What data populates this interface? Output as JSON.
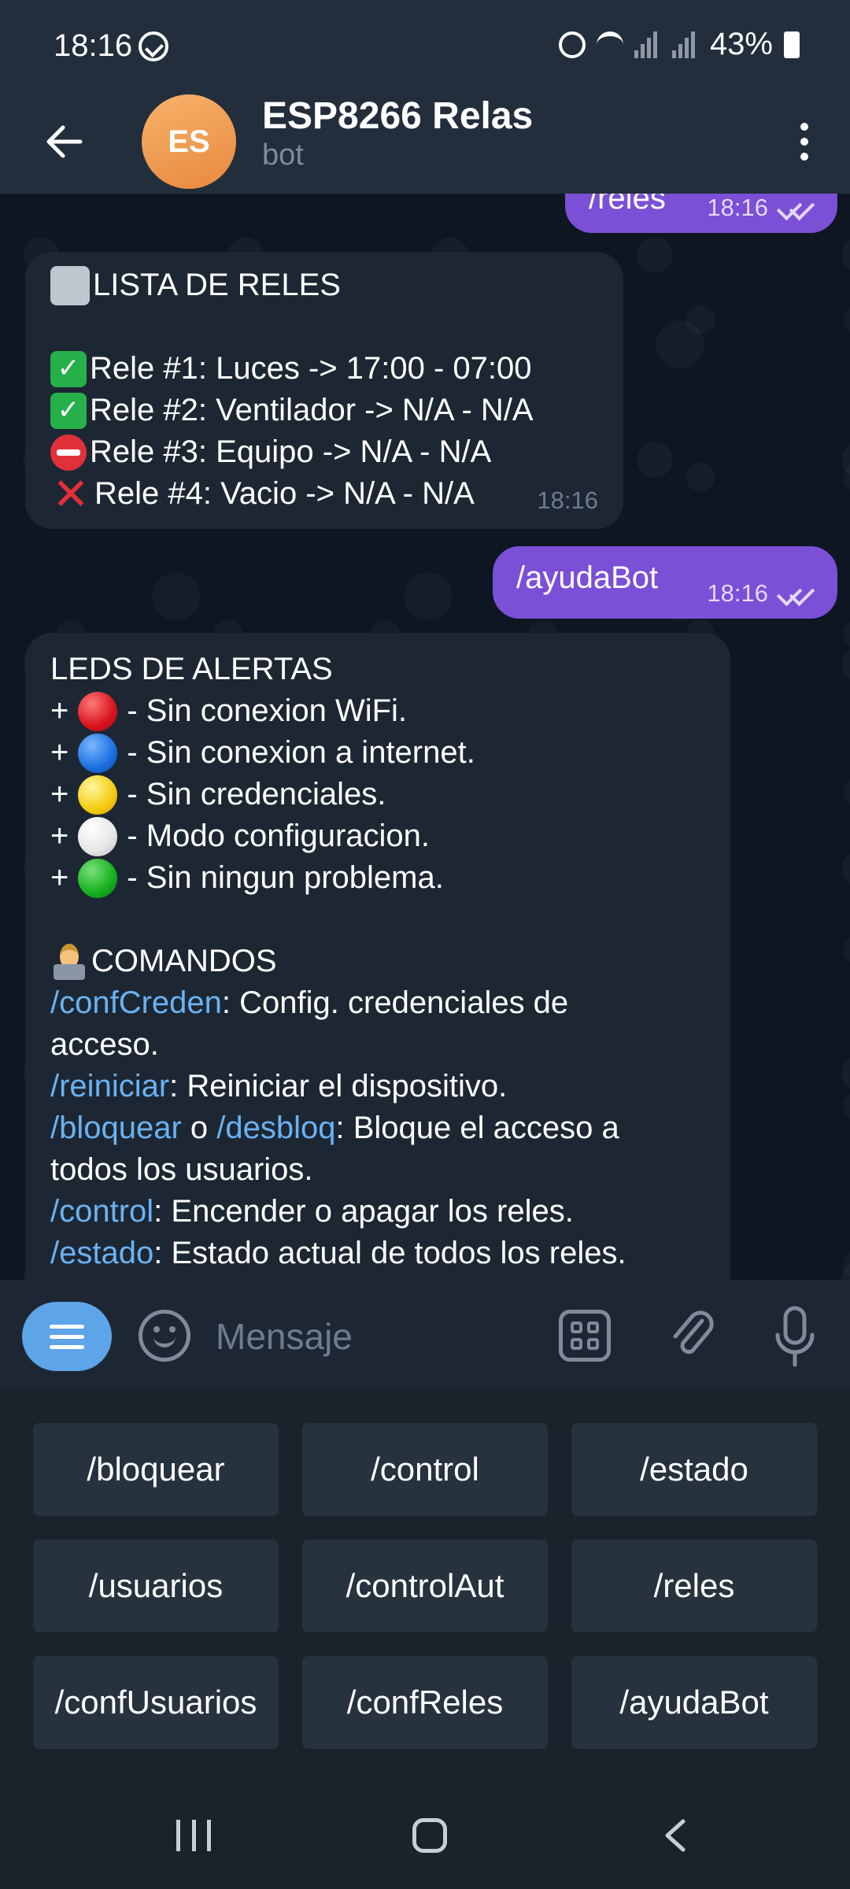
{
  "status_bar": {
    "time": "18:16",
    "battery": "43%",
    "icons": [
      "sync-icon",
      "alarm-icon",
      "wifi-icon",
      "signal-icon",
      "battery-icon"
    ]
  },
  "header": {
    "avatar_initials": "ES",
    "title": "ESP8266 Relas",
    "subtitle": "bot",
    "avatar_color": "#ef9a4c"
  },
  "messages": {
    "m1": {
      "text": "/reles",
      "time": "18:16"
    },
    "m2": {
      "title": "LISTA DE RELES",
      "lines": [
        "Rele #1: Luces -> 17:00 - 07:00",
        "Rele #2: Ventilador -> N/A - N/A",
        "Rele #3: Equipo -> N/A - N/A",
        "Rele #4: Vacio -> N/A - N/A"
      ],
      "time": "18:16"
    },
    "m3": {
      "text": "/ayudaBot",
      "time": "18:16"
    },
    "m4": {
      "leds_title": "LEDS DE ALERTAS",
      "leds": [
        {
          "prefix": "+",
          "text": "- Sin conexion WiFi.",
          "color": "red"
        },
        {
          "prefix": "+",
          "text": "- Sin conexion a internet.",
          "color": "blue"
        },
        {
          "prefix": "+",
          "text": "- Sin credenciales.",
          "color": "yellow"
        },
        {
          "prefix": "+",
          "text": "- Modo configuracion.",
          "color": "white"
        },
        {
          "prefix": "+",
          "text": "- Sin ningun problema.",
          "color": "green"
        }
      ],
      "commands_title": "COMANDOS",
      "confCreden": {
        "cmd": "/confCreden",
        "text": ": Config. credenciales de",
        "cont": "acceso."
      },
      "reiniciar": {
        "cmd": "/reiniciar",
        "text": ": Reiniciar el dispositivo."
      },
      "bloquear": {
        "cmd": "/bloquear",
        "mid": " o ",
        "cmd2": "/desbloq",
        "text": ": Bloque el acceso a",
        "cont": "todos los usuarios."
      },
      "control": {
        "cmd": "/control",
        "text": ": Encender o apagar los reles."
      },
      "estado": {
        "cmd": "/estado",
        "text": ": Estado actual de todos los reles."
      }
    }
  },
  "input": {
    "placeholder": "Mensaje"
  },
  "keyboard": {
    "rows": [
      [
        "/bloquear",
        "/control",
        "/estado"
      ],
      [
        "/usuarios",
        "/controlAut",
        "/reles"
      ],
      [
        "/confUsuarios",
        "/confReles",
        "/ayudaBot"
      ]
    ]
  },
  "colors": {
    "outgoing_bubble": "#7b4fd6",
    "incoming_bubble": "#1d2733",
    "link": "#6ab2f2",
    "header_bg": "#232e3c"
  }
}
